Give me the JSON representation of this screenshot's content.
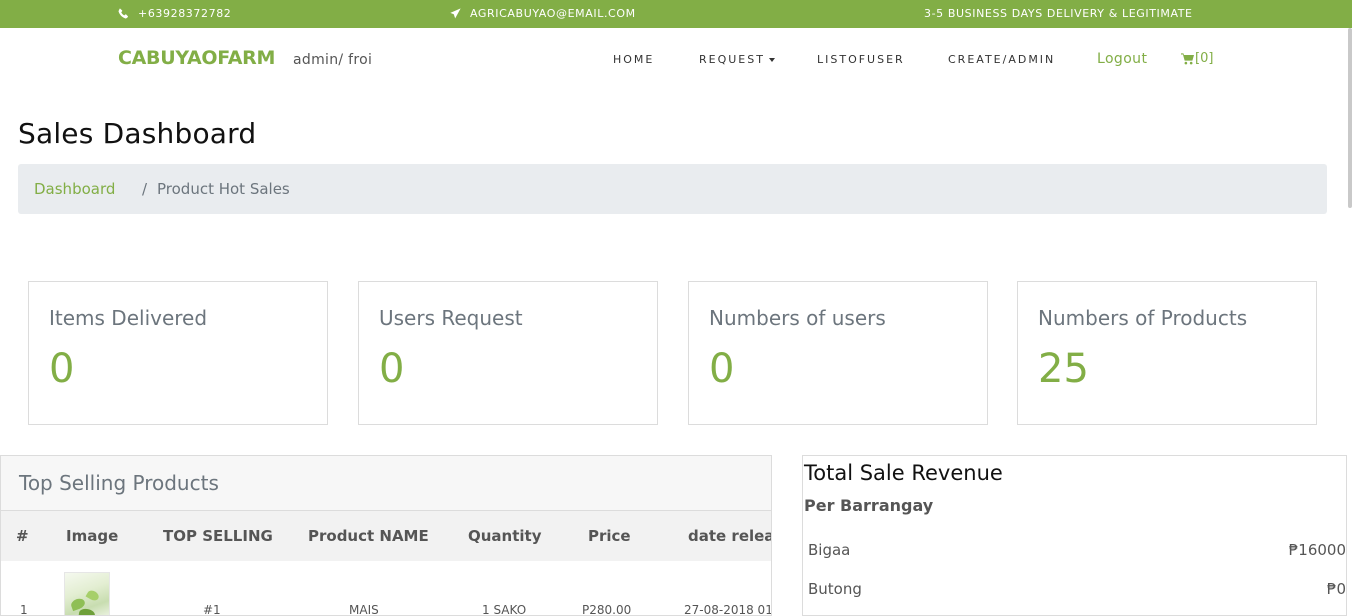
{
  "topbar": {
    "phone": "+63928372782",
    "email": "AGRICABUYAO@EMAIL.COM",
    "delivery": "3-5 BUSINESS DAYS DELIVERY & LEGITIMATE"
  },
  "navbar": {
    "brand": "CABUYAOFARM",
    "user": "admin/ froi",
    "links": {
      "home": "HOME",
      "request": "REQUEST",
      "list": "LISTOFUSER",
      "create": "CREATE/ADMIN",
      "logout": "Logout"
    },
    "cart": "[0]"
  },
  "page": {
    "title": "Sales Dashboard"
  },
  "breadcrumb": {
    "link": "Dashboard",
    "separator": "/",
    "active": "Product Hot Sales"
  },
  "cards": [
    {
      "label": "Items Delivered",
      "value": "0"
    },
    {
      "label": "Users Request",
      "value": "0"
    },
    {
      "label": "Numbers of users",
      "value": "0"
    },
    {
      "label": "Numbers of Products",
      "value": "25"
    }
  ],
  "top_selling": {
    "title": "Top Selling Products",
    "columns": [
      "#",
      "Image",
      "TOP SELLING",
      "Product NAME",
      "Quantity",
      "Price",
      "date relea"
    ],
    "rows": [
      {
        "num": "1",
        "rank": "#1",
        "name": "MAIS",
        "quantity": "1 SAKO",
        "price": "P280.00",
        "date": "27-08-2018 01"
      }
    ]
  },
  "revenue": {
    "title": "Total Sale Revenue",
    "subtitle": "Per Barrangay",
    "rows": [
      {
        "name": "Bigaa",
        "amount": "₱16000"
      },
      {
        "name": "Butong",
        "amount": "₱0"
      }
    ]
  },
  "colors": {
    "accent": "#82ae46",
    "muted": "#6c757d",
    "breadcrumb_bg": "#e9ecef"
  },
  "icons": {
    "phone": "phone-icon",
    "email": "paper-plane-icon",
    "cart": "cart-icon"
  }
}
